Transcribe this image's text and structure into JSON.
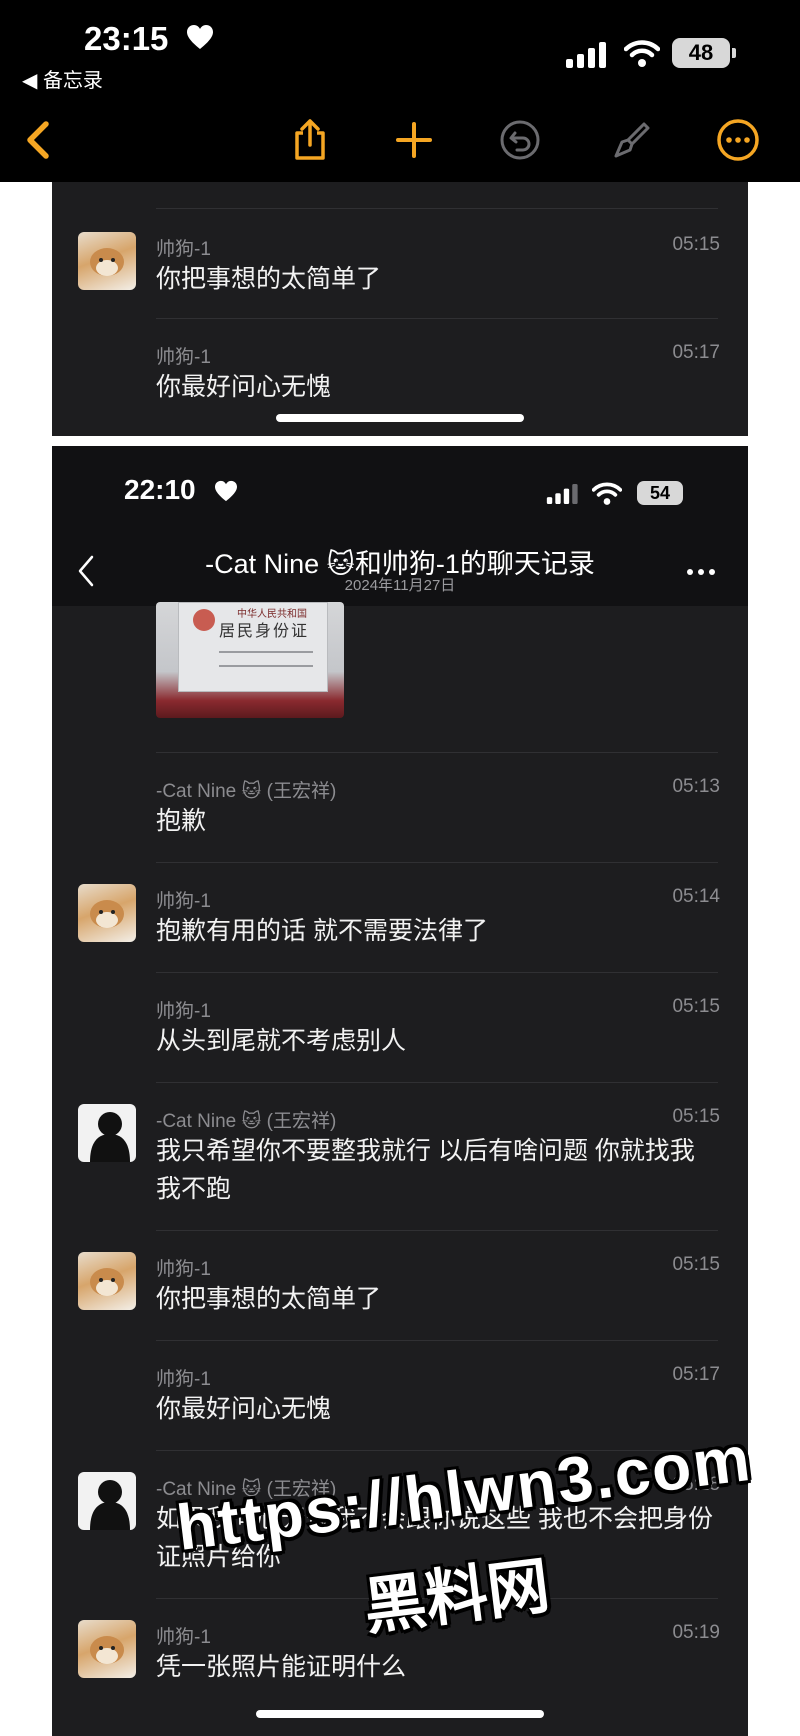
{
  "status_bar": {
    "time": "23:15",
    "back_app": "◀ 备忘录",
    "battery": "48"
  },
  "toolbar": {
    "back_icon": "chevron-left-icon",
    "share_icon": "share-icon",
    "add_icon": "plus-icon",
    "undo_icon": "undo-icon",
    "markup_icon": "brush-icon",
    "more_icon": "more-circle-icon",
    "accent_color": "#f5a623"
  },
  "panel_a": {
    "messages": [
      {
        "sender": "帅狗-1",
        "time": "05:15",
        "text": "你把事想的太简单了",
        "avatar": "dog"
      },
      {
        "sender": "帅狗-1",
        "time": "05:17",
        "text": "你最好问心无愧",
        "avatar": ""
      }
    ]
  },
  "panel_b": {
    "status_time": "22:10",
    "battery": "54",
    "chat_title": "-Cat Nine 🐱和帅狗-1的聊天记录",
    "chat_date": "2024年11月27日",
    "id_photo": {
      "line1": "中华人民共和国",
      "line2": "居民身份证"
    },
    "messages": [
      {
        "sender": "-Cat Nine 🐱 (王宏祥)",
        "time": "05:13",
        "text": "抱歉",
        "avatar": ""
      },
      {
        "sender": "帅狗-1",
        "time": "05:14",
        "text": "抱歉有用的话 就不需要法律了",
        "avatar": "dog"
      },
      {
        "sender": "帅狗-1",
        "time": "05:15",
        "text": "从头到尾就不考虑别人",
        "avatar": ""
      },
      {
        "sender": "-Cat Nine 🐱 (王宏祥)",
        "time": "05:15",
        "text": "我只希望你不要整我就行 以后有啥问题 你就找我 我不跑",
        "avatar": "dark"
      },
      {
        "sender": "帅狗-1",
        "time": "05:15",
        "text": "你把事想的太简单了",
        "avatar": "dog"
      },
      {
        "sender": "帅狗-1",
        "time": "05:17",
        "text": "你最好问心无愧",
        "avatar": ""
      },
      {
        "sender": "-Cat Nine 🐱 (王宏祥)",
        "time": "05:18",
        "text": "如果我问心无愧我不会跟你说这些 我也不会把身份证照片给你",
        "avatar": "dark"
      },
      {
        "sender": "帅狗-1",
        "time": "05:19",
        "text": "凭一张照片能证明什么",
        "avatar": "dog"
      }
    ]
  },
  "watermark": {
    "url": "https://hlwn3.com",
    "name": "黑料网"
  }
}
